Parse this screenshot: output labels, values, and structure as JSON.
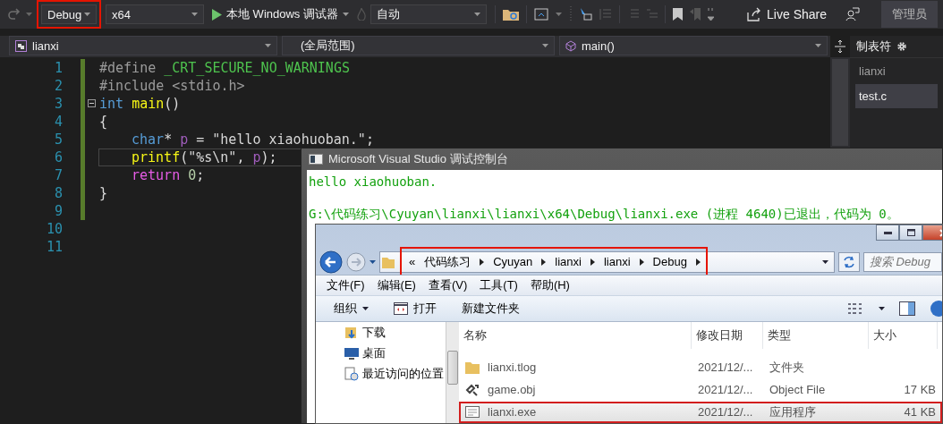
{
  "toolbar": {
    "configuration": {
      "value": "Debug",
      "highlighted": true
    },
    "platform": {
      "value": "x64"
    },
    "run_button": {
      "label": "本地 Windows 调试器"
    },
    "startup_item": {
      "value": "自动"
    },
    "live_share": {
      "label": "Live Share"
    },
    "user_badge": "管理员"
  },
  "navigation_bar": {
    "project": "lianxi",
    "scope": "(全局范围)",
    "member": "main()"
  },
  "editor": {
    "lines": [
      {
        "number": "1",
        "changed": true,
        "collapsible": false,
        "current": false,
        "indent": false,
        "tokens": [
          {
            "kind": "directive",
            "text": "#define "
          },
          {
            "kind": "macro",
            "text": "_CRT_SECURE_NO_WARNINGS"
          }
        ]
      },
      {
        "number": "2",
        "changed": true,
        "collapsible": false,
        "current": false,
        "indent": false,
        "tokens": [
          {
            "kind": "directive",
            "text": "#include <stdio.h>"
          }
        ]
      },
      {
        "number": "3",
        "changed": true,
        "collapsible": true,
        "current": false,
        "indent": false,
        "tokens": [
          {
            "kind": "keyword",
            "text": "int "
          },
          {
            "kind": "function",
            "text": "main"
          },
          {
            "kind": "plain",
            "text": "()"
          }
        ]
      },
      {
        "number": "4",
        "changed": true,
        "collapsible": false,
        "current": false,
        "indent": false,
        "tokens": [
          {
            "kind": "plain",
            "text": "{"
          }
        ]
      },
      {
        "number": "5",
        "changed": true,
        "collapsible": false,
        "current": false,
        "indent": true,
        "tokens": [
          {
            "kind": "keyword",
            "text": "char"
          },
          {
            "kind": "plain",
            "text": "* "
          },
          {
            "kind": "variable",
            "text": "p"
          },
          {
            "kind": "plain",
            "text": " = "
          },
          {
            "kind": "string",
            "text": "\"hello xiaohuoban.\""
          },
          {
            "kind": "plain",
            "text": ";"
          }
        ]
      },
      {
        "number": "6",
        "changed": true,
        "collapsible": false,
        "current": true,
        "indent": true,
        "tokens": [
          {
            "kind": "function",
            "text": "printf"
          },
          {
            "kind": "plain",
            "text": "("
          },
          {
            "kind": "string",
            "text": "\"%s\\n\""
          },
          {
            "kind": "plain",
            "text": ", "
          },
          {
            "kind": "variable",
            "text": "p"
          },
          {
            "kind": "plain",
            "text": ");"
          }
        ]
      },
      {
        "number": "7",
        "changed": true,
        "collapsible": false,
        "current": false,
        "indent": true,
        "tokens": [
          {
            "kind": "control",
            "text": "return "
          },
          {
            "kind": "number",
            "text": "0"
          },
          {
            "kind": "plain",
            "text": ";"
          }
        ]
      },
      {
        "number": "8",
        "changed": true,
        "collapsible": false,
        "current": false,
        "indent": false,
        "tokens": [
          {
            "kind": "plain",
            "text": "}"
          }
        ]
      },
      {
        "number": "9",
        "changed": true,
        "collapsible": false,
        "current": false
      },
      {
        "number": "10",
        "changed": false,
        "collapsible": false,
        "current": false
      },
      {
        "number": "11",
        "changed": false,
        "collapsible": false,
        "current": false
      }
    ]
  },
  "side_panel": {
    "title": "制表符",
    "items": [
      {
        "label": "lianxi",
        "selected": false
      },
      {
        "label": "test.c",
        "selected": true
      }
    ]
  },
  "console_window": {
    "title": "Microsoft Visual Studio 调试控制台",
    "output": "hello xiaohuoban.",
    "exit_message": "G:\\代码练习\\Cyuyan\\lianxi\\lianxi\\x64\\Debug\\lianxi.exe (进程 4640)已退出，代码为 0。"
  },
  "explorer_window": {
    "breadcrumb": {
      "highlighted": true,
      "overflow_mark": "«",
      "items": [
        "代码练习",
        "Cyuyan",
        "lianxi",
        "lianxi",
        "Debug"
      ]
    },
    "search": {
      "placeholder": "搜索 Debug"
    },
    "menu": [
      "文件(F)",
      "编辑(E)",
      "查看(V)",
      "工具(T)",
      "帮助(H)"
    ],
    "commands": [
      {
        "label": "组织",
        "kind": "dropdown"
      },
      {
        "label": "打开",
        "kind": "open"
      },
      {
        "label": "新建文件夹",
        "kind": "plain"
      }
    ],
    "navigation": [
      {
        "label": "下载",
        "kind": "downloads"
      },
      {
        "label": "桌面",
        "kind": "desktop"
      },
      {
        "label": "最近访问的位置",
        "kind": "recent"
      }
    ],
    "columns": [
      "名称",
      "修改日期",
      "类型",
      "大小"
    ],
    "files": [
      {
        "name": "lianxi.tlog",
        "kind": "folder",
        "modified": "2021/12/...",
        "type": "文件夹",
        "selected": false,
        "highlighted": false
      },
      {
        "name": "game.obj",
        "kind": "object",
        "modified": "2021/12/...",
        "type": "Object File",
        "size": "17 KB",
        "selected": false,
        "highlighted": false
      },
      {
        "name": "lianxi.exe",
        "kind": "program",
        "modified": "2021/12/...",
        "type": "应用程序",
        "size": "41 KB",
        "selected": true,
        "highlighted": true
      }
    ]
  }
}
